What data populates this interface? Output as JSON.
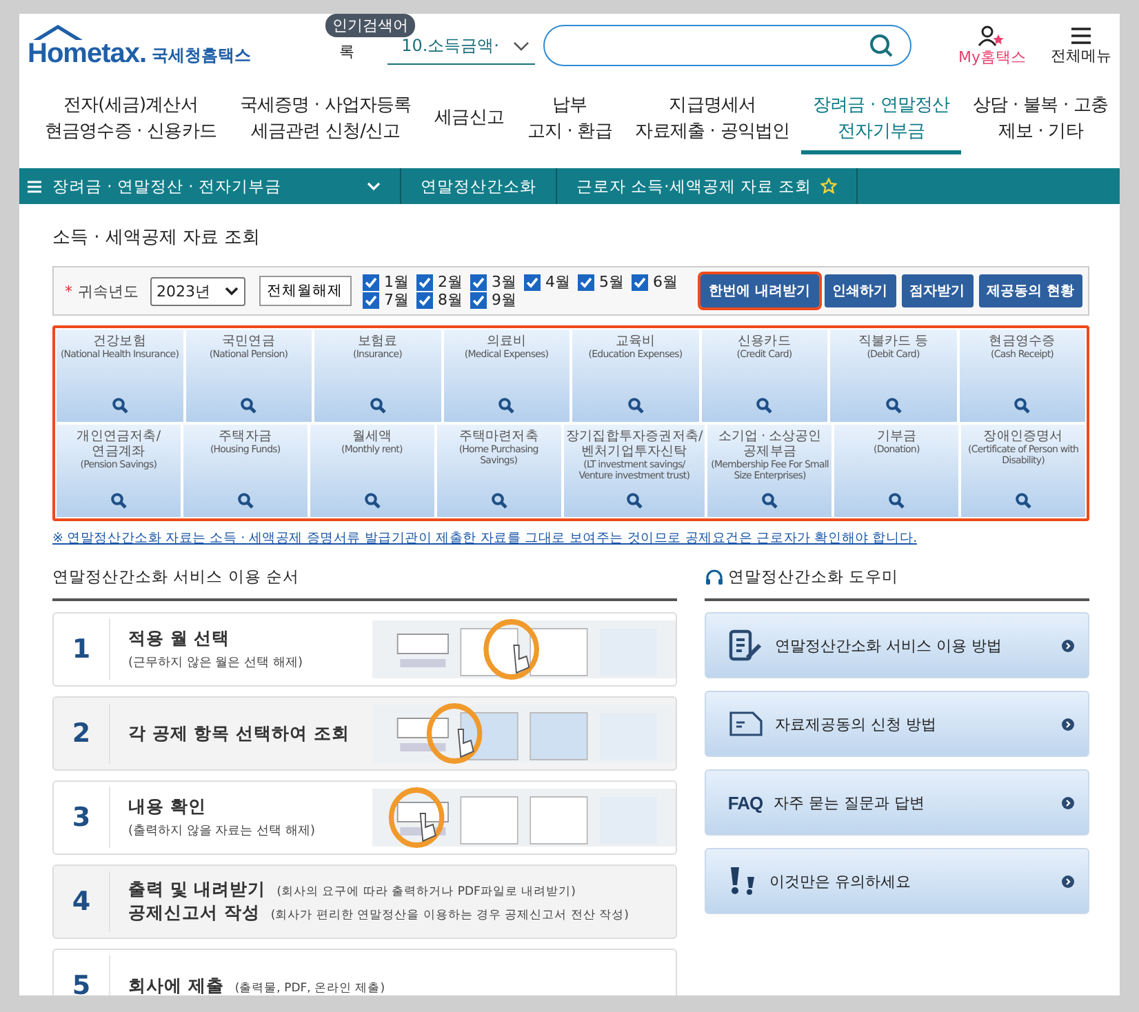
{
  "header": {
    "logo": {
      "wordmark": "Hometax.",
      "subtitle": "국세청홈택스"
    },
    "popular_tag": "인기검색어",
    "popular_prefix": "록",
    "popular_select": "10.소득금액·",
    "my_link": "My홈택스",
    "menu_link": "전체메뉴"
  },
  "nav": [
    {
      "lines": [
        "전자(세금)계산서",
        "현금영수증 · 신용카드"
      ],
      "selected": false
    },
    {
      "lines": [
        "국세증명 · 사업자등록",
        "세금관련 신청/신고"
      ],
      "selected": false
    },
    {
      "lines": [
        "세금신고"
      ],
      "selected": false
    },
    {
      "lines": [
        "납부",
        "고지 · 환급"
      ],
      "selected": false
    },
    {
      "lines": [
        "지급명세서",
        "자료제출 · 공익법인"
      ],
      "selected": false
    },
    {
      "lines": [
        "장려금 · 연말정산",
        "전자기부금"
      ],
      "selected": true
    },
    {
      "lines": [
        "상담 · 불복 · 고충",
        "제보 · 기타"
      ],
      "selected": false
    }
  ],
  "breadcrumb": [
    "장려금 · 연말정산 · 전자기부금",
    "연말정산간소화",
    "근로자 소득·세액공제 자료 조회"
  ],
  "page_title": "소득 · 세액공제 자료 조회",
  "filter": {
    "required_mark": "*",
    "year_label": "귀속년도",
    "year_value": "2023년",
    "clear_button": "전체월해제",
    "months": [
      {
        "label": "1월",
        "checked": true
      },
      {
        "label": "2월",
        "checked": true
      },
      {
        "label": "3월",
        "checked": true
      },
      {
        "label": "4월",
        "checked": true
      },
      {
        "label": "5월",
        "checked": true
      },
      {
        "label": "6월",
        "checked": true
      },
      {
        "label": "7월",
        "checked": true
      },
      {
        "label": "8월",
        "checked": true
      },
      {
        "label": "9월",
        "checked": true
      }
    ],
    "buttons": [
      {
        "label": "한번에 내려받기",
        "highlighted": true
      },
      {
        "label": "인쇄하기",
        "highlighted": false
      },
      {
        "label": "점자받기",
        "highlighted": false
      },
      {
        "label": "제공동의 현황",
        "highlighted": false
      }
    ]
  },
  "categories": [
    {
      "name": "건강보험",
      "english": "(National Health Insurance)"
    },
    {
      "name": "국민연금",
      "english": "(National Pension)"
    },
    {
      "name": "보험료",
      "english": "(Insurance)"
    },
    {
      "name": "의료비",
      "english": "(Medical Expenses)"
    },
    {
      "name": "교육비",
      "english": "(Education Expenses)"
    },
    {
      "name": "신용카드",
      "english": "(Credit Card)"
    },
    {
      "name": "직불카드 등",
      "english": "(Debit Card)"
    },
    {
      "name": "현금영수증",
      "english": "(Cash Receipt)"
    },
    {
      "name": "개인연금저축/ 연금계좌",
      "english": "(Pension Savings)"
    },
    {
      "name": "주택자금",
      "english": "(Housing Funds)"
    },
    {
      "name": "월세액",
      "english": "(Monthly rent)"
    },
    {
      "name": "주택마련저축",
      "english": "(Home Purchasing Savings)"
    },
    {
      "name": "장기집합투자증권저축/ 벤처기업투자신탁",
      "english": "(LT investment savings/ Venture investment trust)"
    },
    {
      "name": "소기업 · 소상공인 공제부금",
      "english": "(Membership Fee For Small Size Enterprises)"
    },
    {
      "name": "기부금",
      "english": "(Donation)"
    },
    {
      "name": "장애인증명서",
      "english": "(Certificate of Person with Disability)"
    }
  ],
  "notice": "※ 연말정산간소화 자료는 소득 · 세액공제 증명서류 발급기관이 제출한 자료를 그대로 보여주는 것이므로 공제요건은 근로자가 확인해야 합니다.",
  "steps_title": "연말정산간소화 서비스 이용 순서",
  "steps": [
    {
      "number": "1",
      "lines": [
        {
          "title": "적용 월 선택"
        }
      ],
      "subtitle": "(근무하지 않은 월은 선택 해제)",
      "illustration": {
        "kind": "picture"
      }
    },
    {
      "number": "2",
      "lines": [
        {
          "title": "각 공제 항목 선택하여 조회"
        }
      ],
      "illustration": {
        "kind": "picture"
      }
    },
    {
      "number": "3",
      "lines": [
        {
          "title": "내용 확인"
        }
      ],
      "subtitle": "(출력하지 않을 자료는 선택 해제)",
      "illustration": {
        "kind": "picture"
      }
    },
    {
      "number": "4",
      "lines": [
        {
          "title": "출력 및 내려받기",
          "note": "(회사의 요구에 따라 출력하거나 PDF파일로 내려받기)"
        },
        {
          "title": "공제신고서 작성",
          "note": "(회사가 편리한 연말정산을 이용하는 경우 공제신고서 전산 작성)"
        }
      ]
    },
    {
      "number": "5",
      "lines": [
        {
          "title": "회사에 제출",
          "note": "(출력물, PDF, 온라인 제출)"
        }
      ]
    }
  ],
  "helper": {
    "title": "연말정산간소화 도우미",
    "items": [
      {
        "kind": "doc",
        "label": "연말정산간소화 서비스 이용 방법"
      },
      {
        "kind": "form",
        "label": "자료제공동의 신청 방법"
      },
      {
        "kind": "faq",
        "icon_text": "FAQ",
        "label": "자주 묻는 질문과 답변"
      },
      {
        "kind": "alert",
        "label": "이것만은 유의하세요"
      }
    ]
  }
}
